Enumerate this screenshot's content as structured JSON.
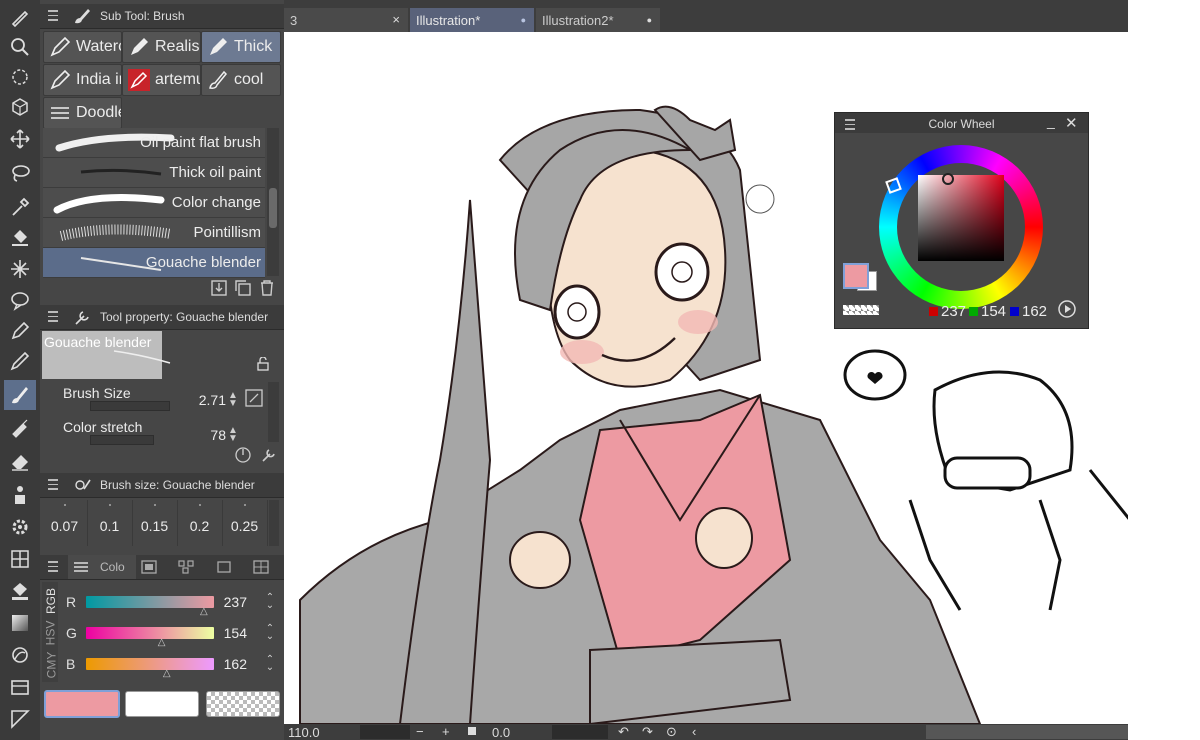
{
  "tabs": [
    {
      "label": "3",
      "active": false
    },
    {
      "label": "Illustration*",
      "active": true
    },
    {
      "label": "Illustration2*",
      "active": false
    }
  ],
  "tab_close_glyph": "×",
  "tab_modified_glyph": "●",
  "subtool_panel": {
    "title": "Sub Tool: Brush",
    "groups": [
      {
        "label": "Waterc",
        "icon": "brush-icon"
      },
      {
        "label": "Realis",
        "icon": "brush-icon"
      },
      {
        "label": "Thick",
        "icon": "brush-icon",
        "selected": true
      },
      {
        "label": "India ir",
        "icon": "brush-icon"
      },
      {
        "label": "artemu",
        "icon": "pen-icon"
      },
      {
        "label": "cool",
        "icon": "brush-icon"
      },
      {
        "label": "Doodle",
        "icon": "list-icon"
      }
    ],
    "brushes": [
      {
        "name": "Oil paint flat brush"
      },
      {
        "name": "Thick oil paint"
      },
      {
        "name": "Color change"
      },
      {
        "name": "Pointillism"
      },
      {
        "name": "Gouache blender",
        "selected": true
      }
    ]
  },
  "tool_property": {
    "title": "Tool property: Gouache blender",
    "preview_name": "Gouache blender",
    "brush_size_label": "Brush Size",
    "brush_size_value": "2.71",
    "color_stretch_label": "Color stretch",
    "color_stretch_value": "78"
  },
  "brush_size_panel": {
    "title": "Brush size: Gouache blender",
    "presets": [
      "0.07",
      "0.1",
      "0.15",
      "0.2",
      "0.25"
    ]
  },
  "color_slider_panel": {
    "tab_label": "Colo",
    "modes": [
      "RGB",
      "HSV",
      "CMY"
    ],
    "channels": [
      {
        "label": "R",
        "value": "237",
        "marker": 0.93
      },
      {
        "label": "G",
        "value": "154",
        "marker": 0.6
      },
      {
        "label": "B",
        "value": "162",
        "marker": 0.64
      }
    ],
    "main_color": "#ed9aa2",
    "sub_color": "#ffffff"
  },
  "color_wheel": {
    "title": "Color Wheel",
    "r": "237",
    "g": "154",
    "b": "162",
    "main_color": "#ed9aa2"
  },
  "status": {
    "zoom": "110.0",
    "rotation": "0.0",
    "minus": "−",
    "plus": "+"
  },
  "tools": [
    "zoom-icon",
    "lasso-select-icon",
    "3d-move-icon",
    "move-icon",
    "lasso-icon",
    "eyedropper-icon",
    "fill-icon",
    "sparkle-icon",
    "balloon-icon",
    "pen-icon",
    "pencil-icon",
    "brush-icon",
    "airbrush-icon",
    "eraser-icon",
    "figure-icon",
    "gear-icon",
    "grid-icon",
    "bucket-icon",
    "gradient-icon",
    "blend-icon",
    "frame-icon",
    "ruler-icon"
  ]
}
